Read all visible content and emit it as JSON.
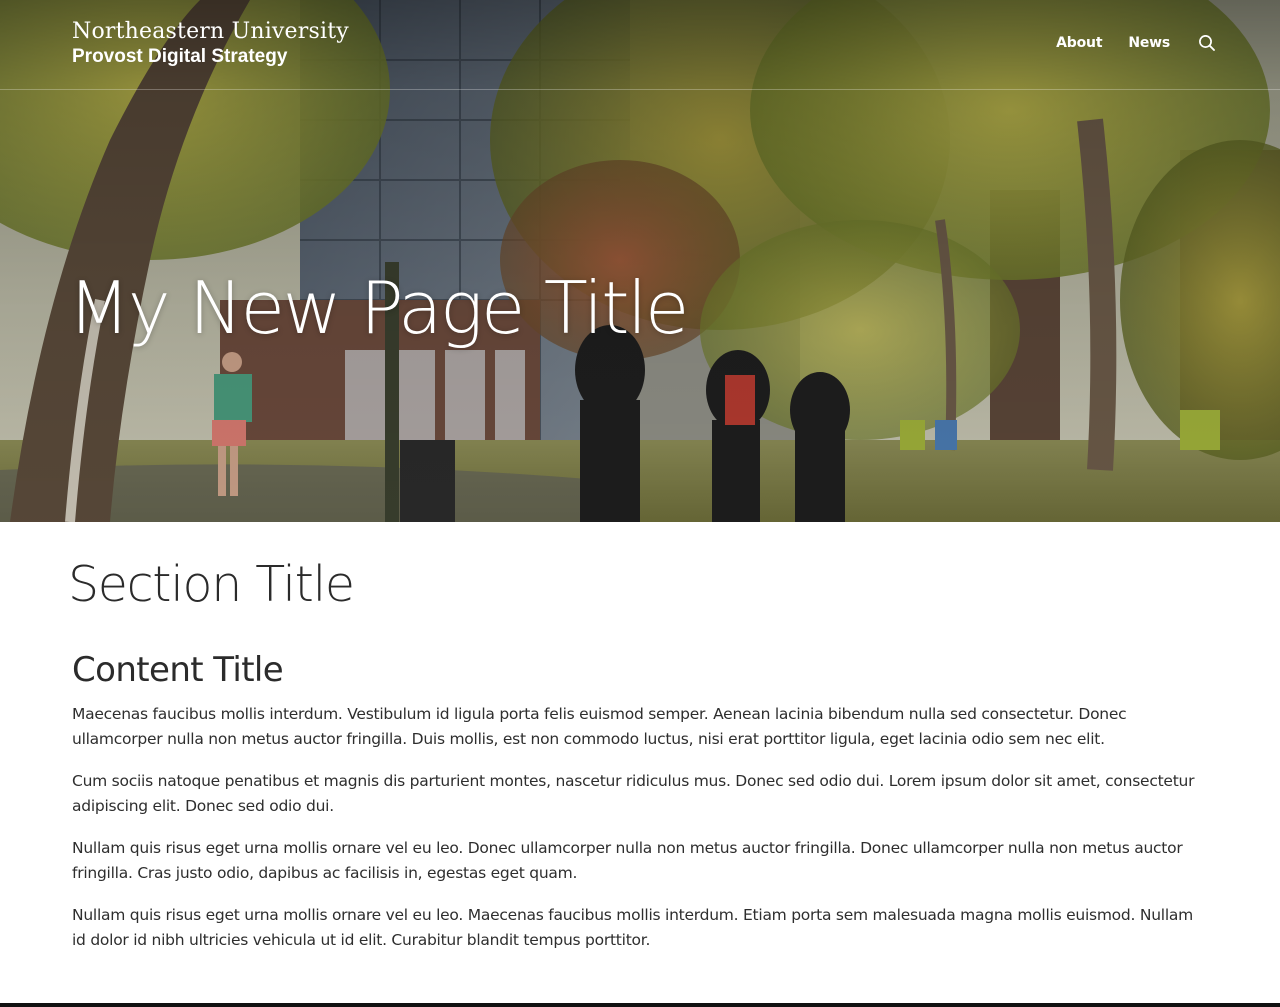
{
  "brand": {
    "university": "Northeastern University",
    "unit": "Provost Digital Strategy"
  },
  "nav": {
    "items": [
      {
        "label": "About"
      },
      {
        "label": "News"
      }
    ],
    "search_icon": "search-icon"
  },
  "hero": {
    "title": "My New Page Title"
  },
  "section": {
    "title": "Section Title",
    "content_title": "Content Title",
    "paragraphs": [
      "Maecenas faucibus mollis interdum. Vestibulum id ligula porta felis euismod semper. Aenean lacinia bibendum nulla sed consectetur. Donec ullamcorper nulla non metus auctor fringilla. Duis mollis, est non commodo luctus, nisi erat porttitor ligula, eget lacinia odio sem nec elit.",
      "Cum sociis natoque penatibus et magnis dis parturient montes, nascetur ridiculus mus. Donec sed odio dui. Lorem ipsum dolor sit amet, consectetur adipiscing elit. Donec sed odio dui.",
      "Nullam quis risus eget urna mollis ornare vel eu leo. Donec ullamcorper nulla non metus auctor fringilla. Donec ullamcorper nulla non metus auctor fringilla. Cras justo odio, dapibus ac facilisis in, egestas eget quam.",
      "Nullam quis risus eget urna mollis ornare vel eu leo. Maecenas faucibus mollis interdum. Etiam porta sem malesuada magna mollis euismod. Nullam id dolor id nibh ultricies vehicula ut id elit. Curabitur blandit tempus porttitor."
    ]
  },
  "colors": {
    "text": "#2b2b2b",
    "header_text": "#ffffff",
    "footer_bar": "#111111"
  }
}
